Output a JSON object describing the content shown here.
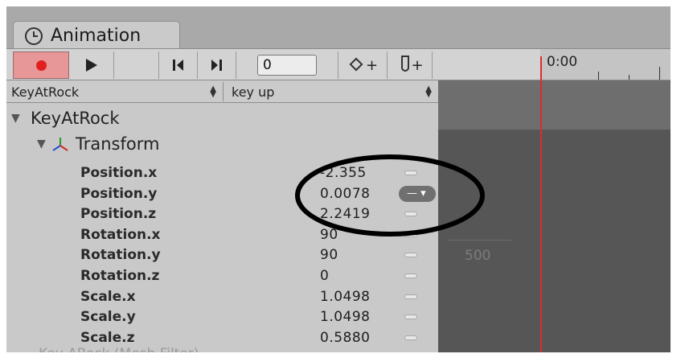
{
  "window": {
    "tab_label": "Animation",
    "tab_icon": "clock-icon"
  },
  "toolbar": {
    "record_icon": "record-dot-icon",
    "play_icon": "play-icon",
    "frame_value": "0",
    "add_keyframe_plus": "+",
    "add_event_plus": "+"
  },
  "timeline": {
    "time_label": "0:00",
    "playhead_color": "#e22a2a"
  },
  "dropdowns": {
    "object": "KeyAtRock",
    "clip": "key up"
  },
  "tree": {
    "object_name": "KeyAtRock",
    "component_name": "Transform",
    "properties": [
      {
        "name": "Position.x",
        "value": "-2.355"
      },
      {
        "name": "Position.y",
        "value": "0.0078"
      },
      {
        "name": "Position.z",
        "value": "2.2419"
      },
      {
        "name": "Rotation.x",
        "value": "90"
      },
      {
        "name": "Rotation.y",
        "value": "90"
      },
      {
        "name": "Rotation.z",
        "value": "0"
      },
      {
        "name": "Scale.x",
        "value": "1.0498"
      },
      {
        "name": "Scale.y",
        "value": "1.0498"
      },
      {
        "name": "Scale.z",
        "value": "0.5880"
      }
    ],
    "ghost_row": "Key ARock (Mesh Filter)"
  },
  "curve": {
    "axis_label": "500"
  },
  "colors": {
    "record_bg": "#e79797",
    "record_dot": "#e21f1f",
    "annotation": "#000000"
  }
}
